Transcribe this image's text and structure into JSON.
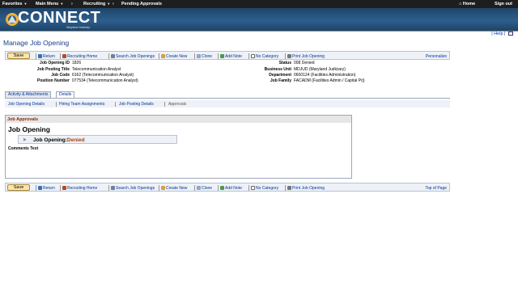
{
  "topnav": {
    "favorites": "Favorites",
    "main_menu": "Main Menu",
    "recruiting": "Recruiting",
    "pending": "Pending Approvals",
    "home": "Home",
    "signout": "Sign out"
  },
  "banner": {
    "logo": "CONNECT",
    "tagline": "Maryland Judiciary"
  },
  "header": {
    "help": "Help"
  },
  "page": {
    "title": "Manage Job Opening"
  },
  "toolbar": {
    "save": "Save",
    "return": "Return",
    "recruiting_home": "Recruiting Home",
    "search": "Search Job Openings",
    "create": "Create New",
    "clone": "Clone",
    "add_note": "Add Note",
    "no_category": "No Category",
    "print": "Print Job Opening",
    "personalize": "Personalize",
    "top_of_page": "Top of Page"
  },
  "summary": {
    "job_opening_id_label": "Job Opening ID",
    "job_opening_id": "1826",
    "posting_title_label": "Job Posting Title",
    "posting_title": "Telecommunication Analyst",
    "job_code_label": "Job Code",
    "job_code": "6162 (Telecommunication Analyst)",
    "position_label": "Position Number",
    "position": "077534 (Telecommunication Analyst)",
    "status_label": "Status",
    "status": "008 Denied",
    "bu_label": "Business Unit",
    "bu": "MDJUD (Maryland Judiciary)",
    "dept_label": "Department",
    "dept": "0600124 (Facilities Administration)",
    "family_label": "Job Family",
    "family": "FACADM (Facilities Admin / Capital Prj)"
  },
  "tabs": [
    "Activity & Attachments",
    "Details"
  ],
  "subnav": [
    "Job Opening Details",
    "Hiring Team Assignments",
    "Job Posting Details",
    "Approvals"
  ],
  "approvals": {
    "header": "Job Approvals",
    "title": "Job Opening",
    "row_label": "Job Opening:",
    "row_status": "Denied",
    "comments": "Comments Text"
  },
  "colors": {
    "accent": "#1a3c8c",
    "denied": "#b23b0e",
    "banner": "#2d5e8c"
  }
}
